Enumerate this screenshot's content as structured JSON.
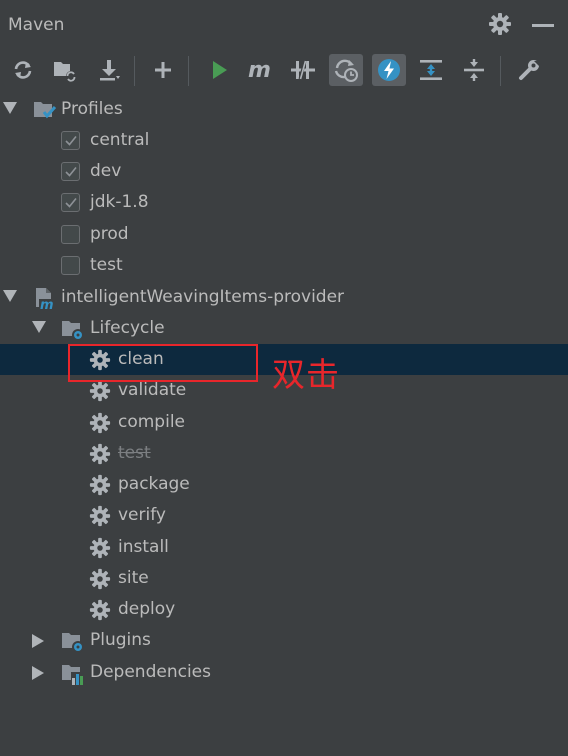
{
  "panel": {
    "title": "Maven"
  },
  "toolbar": {
    "buttons": [
      {
        "name": "reload-all-icon",
        "label": "Reload All Maven Projects"
      },
      {
        "name": "generate-sources-icon",
        "label": "Generate Sources"
      },
      {
        "name": "download-icon",
        "label": "Download Sources"
      },
      {
        "name": "add-icon",
        "label": "Add Maven Projects"
      },
      {
        "name": "run-icon",
        "label": "Run Maven Build"
      },
      {
        "name": "execute-goal-icon",
        "label": "Execute Maven Goal"
      },
      {
        "name": "toggle-offline-icon",
        "label": "Toggle Offline Mode"
      },
      {
        "name": "skip-tests-icon",
        "label": "Toggle Skip Tests Mode"
      },
      {
        "name": "show-dependencies-icon",
        "label": "Show Dependencies"
      },
      {
        "name": "expand-all-icon",
        "label": "Expand All"
      },
      {
        "name": "collapse-all-icon",
        "label": "Collapse All"
      },
      {
        "name": "settings-wrench-icon",
        "label": "Maven Settings"
      }
    ]
  },
  "tree": {
    "profiles": {
      "label": "Profiles",
      "items": [
        {
          "label": "central",
          "checked": true
        },
        {
          "label": "dev",
          "checked": true
        },
        {
          "label": "jdk-1.8",
          "checked": true
        },
        {
          "label": "prod",
          "checked": false
        },
        {
          "label": "test",
          "checked": false
        }
      ]
    },
    "project": {
      "label": "intelligentWeavingItems-provider",
      "lifecycle": {
        "label": "Lifecycle",
        "goals": [
          {
            "label": "clean",
            "selected": true,
            "skipped": false
          },
          {
            "label": "validate",
            "selected": false,
            "skipped": false
          },
          {
            "label": "compile",
            "selected": false,
            "skipped": false
          },
          {
            "label": "test",
            "selected": false,
            "skipped": true
          },
          {
            "label": "package",
            "selected": false,
            "skipped": false
          },
          {
            "label": "verify",
            "selected": false,
            "skipped": false
          },
          {
            "label": "install",
            "selected": false,
            "skipped": false
          },
          {
            "label": "site",
            "selected": false,
            "skipped": false
          },
          {
            "label": "deploy",
            "selected": false,
            "skipped": false
          }
        ]
      },
      "plugins": {
        "label": "Plugins"
      },
      "dependencies": {
        "label": "Dependencies"
      }
    }
  },
  "annotation": {
    "text": "双击",
    "color": "#e8262b"
  },
  "colors": {
    "background": "#3c3f41",
    "selection": "#0d293e",
    "text": "#bbbbbb",
    "run_green": "#499c54",
    "accent_blue": "#3592c4"
  }
}
